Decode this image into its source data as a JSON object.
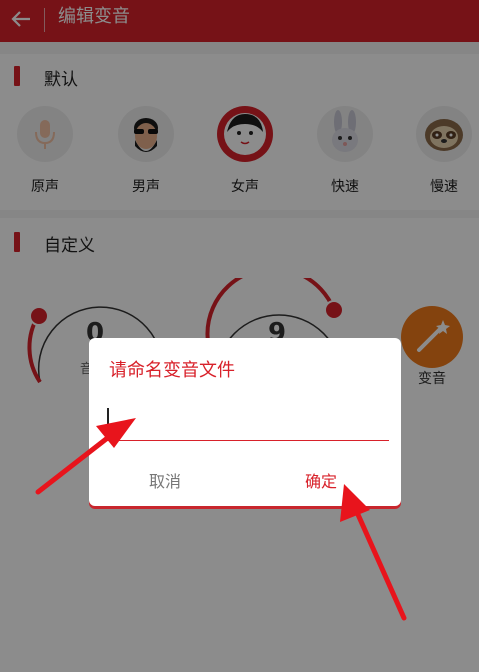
{
  "header": {
    "title": "编辑变音",
    "icon": "back-arrow-icon"
  },
  "default_section": {
    "title": "默认",
    "presets": [
      {
        "label": "原声",
        "icon": "microphone-icon"
      },
      {
        "label": "男声",
        "icon": "bearded-man-icon"
      },
      {
        "label": "女声",
        "icon": "girl-face-icon",
        "selected": true
      },
      {
        "label": "快速",
        "icon": "rabbit-icon"
      },
      {
        "label": "慢速",
        "icon": "sloth-icon"
      }
    ]
  },
  "custom_section": {
    "title": "自定义",
    "dial1": {
      "value": "0",
      "caption": "音"
    },
    "dial2": {
      "value": "9"
    },
    "change_button": {
      "label": "变音",
      "icon": "magic-wand-icon"
    }
  },
  "dialog": {
    "title": "请命名变音文件",
    "input_value": "",
    "cancel_label": "取消",
    "confirm_label": "确定"
  },
  "colors": {
    "accent": "#d8212a",
    "changer": "#f07b1b"
  }
}
